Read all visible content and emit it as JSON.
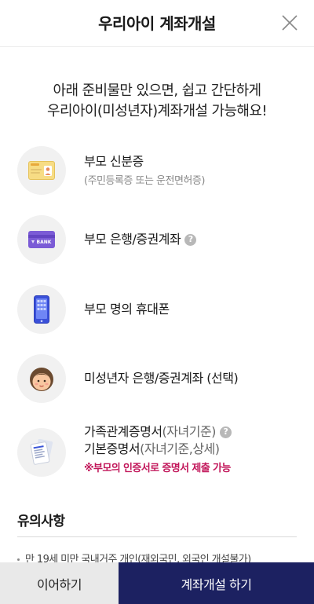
{
  "header": {
    "title": "우리아이 계좌개설",
    "close_icon": "close-icon"
  },
  "intro": {
    "line1": "아래 준비물만 있으면, 쉽고 간단하게",
    "line2": "우리아이(미성년자)계좌개설 가능해요!"
  },
  "requirements": [
    {
      "icon": "id-card-icon",
      "label": "부모 신분증",
      "sub": "(주민등록증 또는 운전면허증)"
    },
    {
      "icon": "bank-card-icon",
      "label": "부모 은행/증권계좌",
      "help": "?"
    },
    {
      "icon": "mobile-phone-icon",
      "label": "부모 명의 휴대폰"
    },
    {
      "icon": "child-face-icon",
      "label": "미성년자 은행/증권계좌 (선택)"
    },
    {
      "icon": "document-icon",
      "label_a": "가족관계증명서",
      "label_a_paren": "(자녀기준)",
      "label_b": "기본증명서",
      "label_b_paren": "(자녀기준,상세)",
      "help": "?",
      "notice": "※부모의 인증서로 증명서 제출 가능"
    }
  ],
  "caution": {
    "title": "유의사항",
    "items": [
      "만 19세 미만 국내거주 개인(재외국민, 외국인 개설불가)"
    ]
  },
  "bottom": {
    "continue_label": "이어하기",
    "open_label": "계좌개설 하기"
  },
  "colors": {
    "primary": "#1c2161",
    "notice": "#c2185b",
    "secondary_button": "#e9e9e9"
  }
}
